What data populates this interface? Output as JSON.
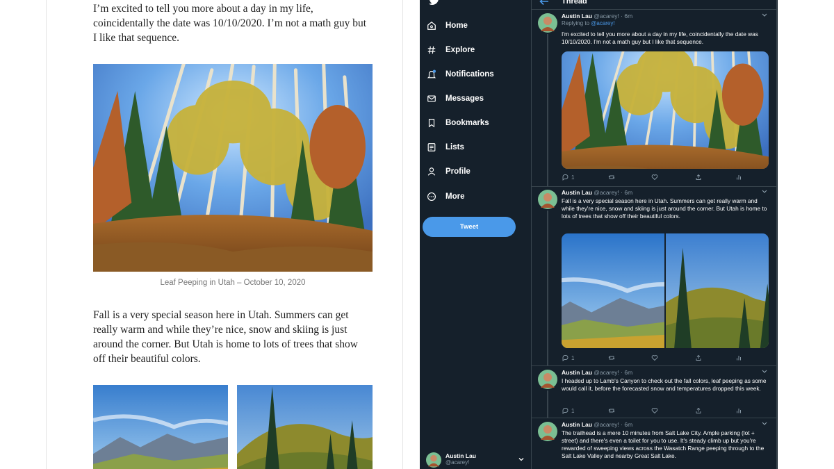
{
  "blog": {
    "paragraph1": "I’m excited to tell you more about a day in my life, coincidentally the date was 10/10/2020. I’m not a math guy but I like that sequence.",
    "caption": "Leaf Peeping in Utah – October 10, 2020",
    "paragraph2": "Fall is a very special season here in Utah. Summers can get really warm and while they’re nice, snow and skiing is just around the corner. But Utah is home to lots of trees that show off their beautiful colors."
  },
  "twitter": {
    "nav": [
      {
        "label": "Home",
        "icon": "home-icon"
      },
      {
        "label": "Explore",
        "icon": "hashtag-icon"
      },
      {
        "label": "Notifications",
        "icon": "bell-icon"
      },
      {
        "label": "Messages",
        "icon": "envelope-icon"
      },
      {
        "label": "Bookmarks",
        "icon": "bookmark-icon"
      },
      {
        "label": "Lists",
        "icon": "list-icon"
      },
      {
        "label": "Profile",
        "icon": "person-icon"
      },
      {
        "label": "More",
        "icon": "more-circle-icon"
      }
    ],
    "tweet_button": "Tweet",
    "account": {
      "name": "Austin Lau",
      "handle": "@acarey!"
    },
    "thread_title": "Thread",
    "tweets": [
      {
        "name": "Austin Lau",
        "handle": "@acarey! · 6m",
        "replying_prefix": "Replying to ",
        "replying_to": "@acarey!",
        "text": "I'm excited to tell you more about a day in my life, coincidentally the date was 10/10/2020. I'm not a math guy but I like that sequence.",
        "replies": "1",
        "retweets": "",
        "likes": ""
      },
      {
        "name": "Austin Lau",
        "handle": "@acarey! · 6m",
        "text": "Fall is a very special season here in Utah. Summers can get really warm and while they're nice, snow and skiing is just around the corner. But Utah is home to lots of trees that show off their beautiful colors.",
        "replies": "1",
        "retweets": "",
        "likes": ""
      },
      {
        "name": "Austin Lau",
        "handle": "@acarey! · 6m",
        "text": "I headed up to Lamb's Canyon to check out the fall colors, leaf peeping as some would call it, before the forecasted snow and temperatures dropped this week.",
        "replies": "1",
        "retweets": "",
        "likes": ""
      },
      {
        "name": "Austin Lau",
        "handle": "@acarey! · 6m",
        "text": "The trailhead is a mere 10 minutes from Salt Lake City. Ample parking (lot + street) and there's even a toilet for you to use. It's steady climb up but you're rewarded of sweeping views across the Wasatch Range peeping through to the Salt Lake Valley and nearby Great Salt Lake.",
        "replies": "",
        "retweets": "",
        "likes": ""
      }
    ]
  },
  "colors": {
    "twitter_bg": "#15202b",
    "twitter_accent": "#4a99e9",
    "twitter_muted": "#8899a6",
    "divider": "#38444d"
  }
}
